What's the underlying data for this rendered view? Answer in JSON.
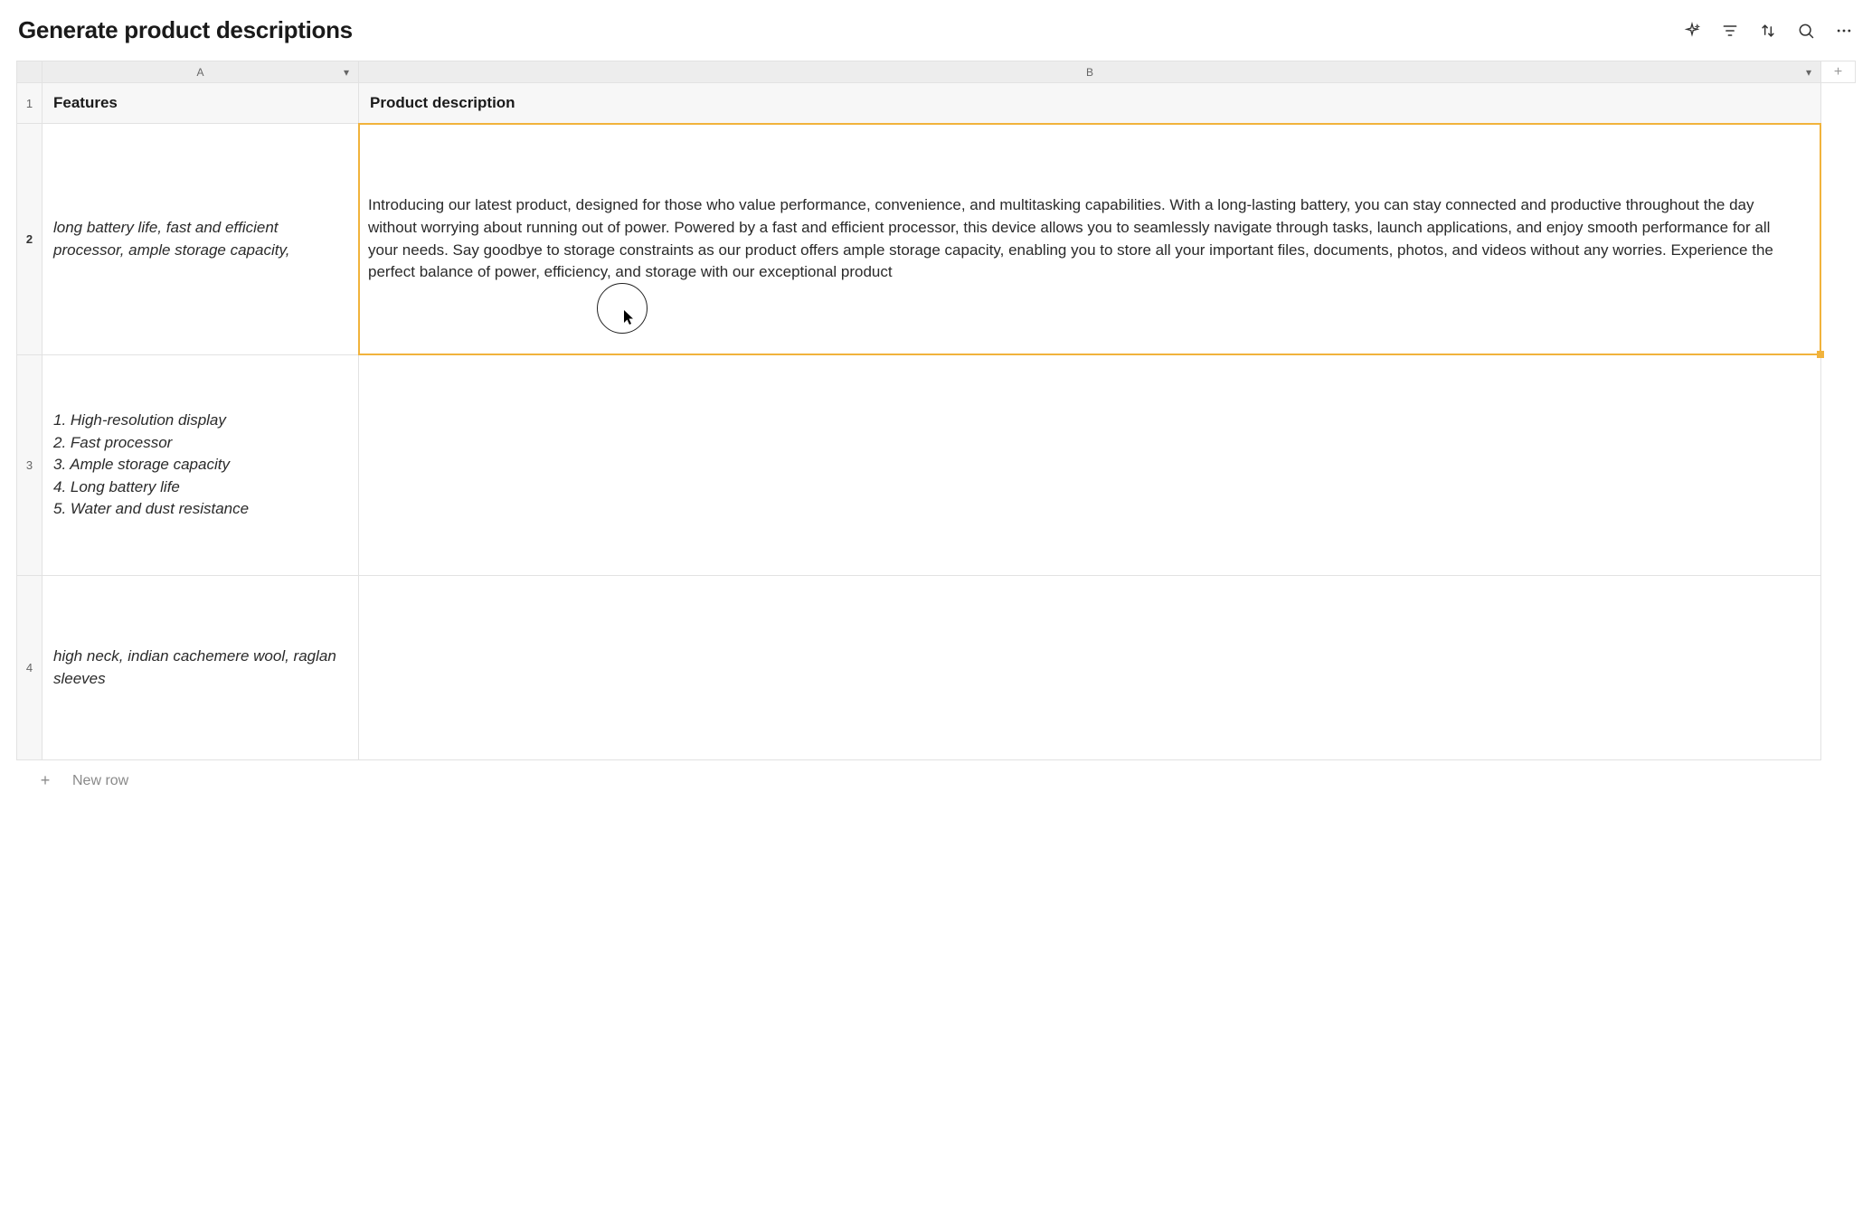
{
  "header": {
    "title": "Generate product descriptions"
  },
  "columns": {
    "a": {
      "letter": "A",
      "name": "Features"
    },
    "b": {
      "letter": "B",
      "name": "Product description"
    }
  },
  "rows": [
    {
      "num": "2",
      "features": "long battery life, fast and efficient processor, ample storage capacity,",
      "description": "Introducing our latest product, designed for those who value performance, convenience, and multitasking capabilities. With a long-lasting battery, you can stay connected and productive throughout the day without worrying about running out of power. Powered by a fast and efficient processor, this device allows you to seamlessly navigate through tasks, launch applications, and enjoy smooth performance for all your needs. Say goodbye to storage constraints as our product offers ample storage capacity, enabling you to store all your important files, documents, photos, and videos without any worries. Experience the perfect balance of power, efficiency, and storage with our exceptional product"
    },
    {
      "num": "3",
      "features_list": [
        "1. High-resolution display",
        "2. Fast processor",
        "3. Ample storage capacity",
        "4. Long battery life",
        "5. Water and dust resistance"
      ],
      "description": ""
    },
    {
      "num": "4",
      "features": "high neck, indian cachemere wool, raglan sleeves",
      "description": ""
    }
  ],
  "header_row_num": "1",
  "new_row_label": "New row"
}
